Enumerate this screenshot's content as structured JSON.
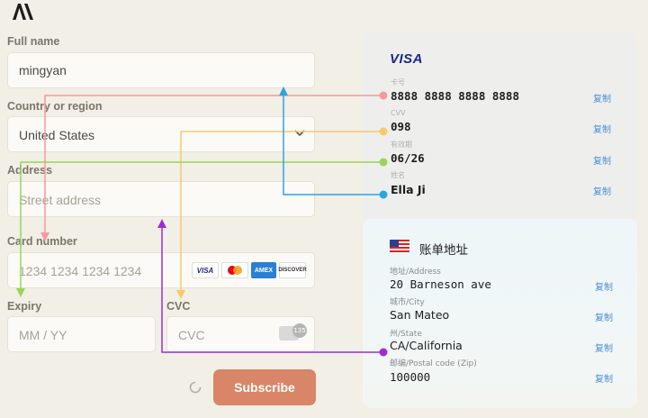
{
  "form": {
    "full_name_label": "Full name",
    "full_name_value": "mingyan",
    "country_label": "Country or region",
    "country_value": "United States",
    "address_label": "Address",
    "address_placeholder": "Street address",
    "card_label": "Card number",
    "card_placeholder": "1234 1234 1234 1234",
    "card_brands": [
      "VISA",
      "mastercard",
      "AMEX",
      "DISCOVER"
    ],
    "expiry_label": "Expiry",
    "expiry_placeholder": "MM / YY",
    "cvc_label": "CVC",
    "cvc_placeholder": "CVC",
    "cvc_badge": "135",
    "subscribe_label": "Subscribe"
  },
  "card_panel": {
    "brand": "VISA",
    "fields": [
      {
        "label": "卡号",
        "value": "8888 8888 8888 8888",
        "copy": "复制"
      },
      {
        "label": "CVV",
        "value": "098",
        "copy": "复制"
      },
      {
        "label": "有效期",
        "value": "06/26",
        "copy": "复制"
      },
      {
        "label": "姓名",
        "value": "Ella Ji",
        "copy": "复制"
      }
    ]
  },
  "billing_panel": {
    "title": "账单地址",
    "fields": [
      {
        "label": "地址/Address",
        "value": "20 Barneson ave",
        "copy": "复制"
      },
      {
        "label": "城市/City",
        "value": "San Mateo",
        "copy": "复制"
      },
      {
        "label": "州/State",
        "value": "CA/California",
        "copy": "复制"
      },
      {
        "label": "邮编/Postal code (Zip)",
        "value": "100000",
        "copy": "复制"
      }
    ]
  },
  "colors": {
    "accent_button": "#d98568",
    "arrow_card": "#f59a9a",
    "arrow_cvv": "#f9c96b",
    "arrow_expiry": "#9bd45b",
    "arrow_name": "#2aa6e0",
    "arrow_state": "#9b2fd1",
    "copy_link": "#4a8ed6",
    "visa_blue": "#1a2a87"
  }
}
